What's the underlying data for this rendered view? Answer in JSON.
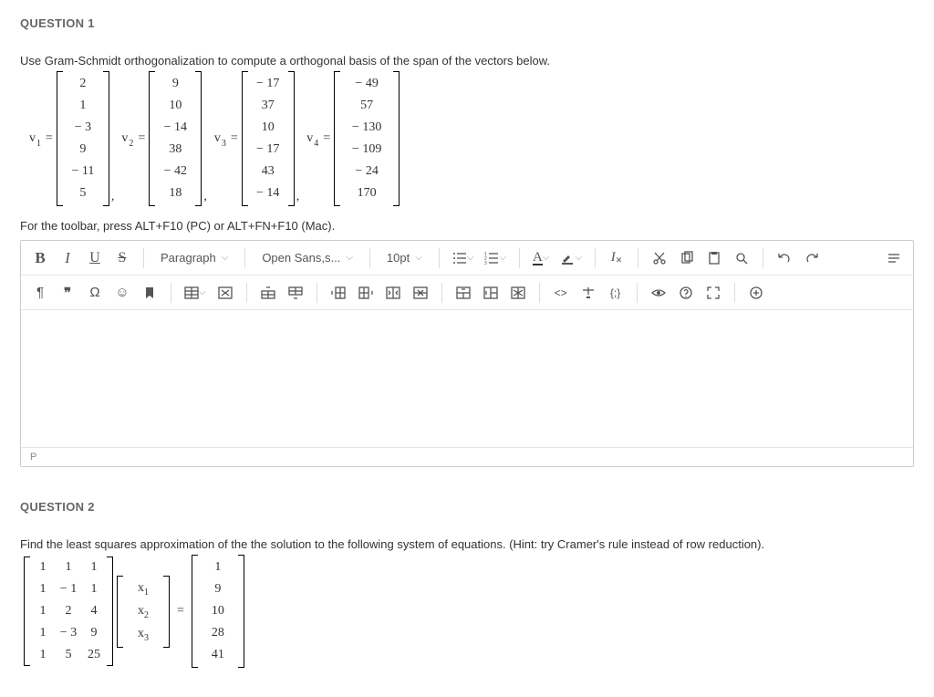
{
  "q1": {
    "header": "QUESTION 1",
    "prompt": "Use Gram-Schmidt orthogonalization to compute a orthogonal basis of the span of the vectors below.",
    "vectors": {
      "labels": [
        "v",
        "v",
        "v",
        "v"
      ],
      "subs": [
        "1",
        "2",
        "3",
        "4"
      ],
      "cols": [
        [
          "2",
          "1",
          "− 3",
          "9",
          "− 11",
          "5"
        ],
        [
          "9",
          "10",
          "− 14",
          "38",
          "− 42",
          "18"
        ],
        [
          "− 17",
          "37",
          "10",
          "− 17",
          "43",
          "− 14"
        ],
        [
          "− 49",
          "57",
          "− 130",
          "− 109",
          "− 24",
          "170"
        ]
      ]
    },
    "hint": "For the toolbar, press ALT+F10 (PC) or ALT+FN+F10 (Mac).",
    "status": "P"
  },
  "toolbar": {
    "bold": "B",
    "italic": "I",
    "underline": "U",
    "strike": "S",
    "para": "Paragraph",
    "font": "Open Sans,s...",
    "size": "10pt",
    "fontcolor": "A",
    "codebraces": "{;}",
    "codeangle": "<>"
  },
  "q2": {
    "header": "QUESTION 2",
    "prompt": "Find the least squares approximation of the the solution to the following system of equations. (Hint: try Cramer's rule instead of row reduction).",
    "A": [
      [
        "1",
        "1",
        "1"
      ],
      [
        "1",
        "− 1",
        "1"
      ],
      [
        "1",
        "2",
        "4"
      ],
      [
        "1",
        "− 3",
        "9"
      ],
      [
        "1",
        "5",
        "25"
      ]
    ],
    "x": [
      "x",
      "x",
      "x"
    ],
    "xsubs": [
      "1",
      "2",
      "3"
    ],
    "b": [
      "1",
      "9",
      "10",
      "28",
      "41"
    ]
  }
}
